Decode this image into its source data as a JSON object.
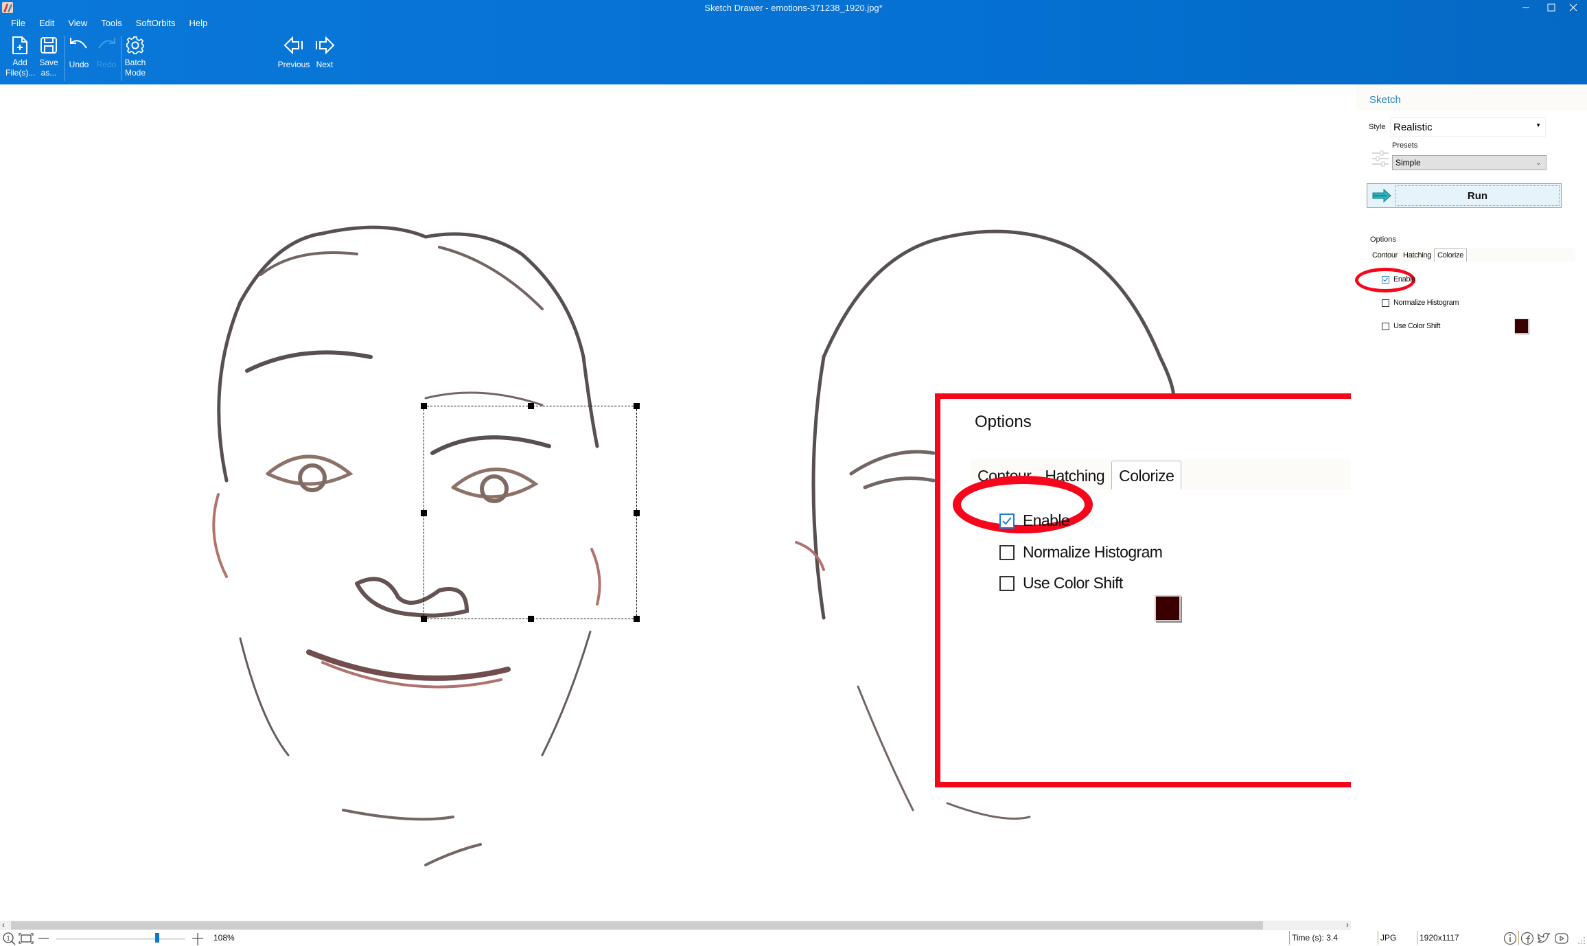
{
  "window": {
    "title": "Sketch Drawer - emotions-371238_1920.jpg*",
    "controls": [
      "minimize-icon",
      "maximize-icon",
      "close-icon"
    ]
  },
  "menu": [
    {
      "label": "File",
      "accel": "F"
    },
    {
      "label": "Edit",
      "accel": "E"
    },
    {
      "label": "View",
      "accel": "V"
    },
    {
      "label": "Tools",
      "accel": "T"
    },
    {
      "label": "SoftOrbits",
      "accel": ""
    },
    {
      "label": "Help",
      "accel": "H"
    }
  ],
  "toolbar": {
    "add_files": {
      "line1": "Add",
      "line2": "File(s)...",
      "icon": "add-file-icon"
    },
    "save_as": {
      "line1": "Save",
      "line2": "as...",
      "icon": "save-icon"
    },
    "undo": {
      "label": "Undo",
      "icon": "undo-icon"
    },
    "redo": {
      "label": "Redo",
      "icon": "redo-icon",
      "disabled": true
    },
    "batch_mode": {
      "line1": "Batch",
      "line2": "Mode",
      "icon": "gear-icon"
    },
    "previous": {
      "label": "Previous",
      "icon": "previous-arrow-icon"
    },
    "next": {
      "label": "Next",
      "icon": "next-arrow-icon"
    }
  },
  "panel": {
    "title": "Sketch",
    "style_label": "Style",
    "style_value": "Realistic",
    "presets_label": "Presets",
    "presets_value": "Simple",
    "run_label": "Run",
    "options_label": "Options",
    "tabs": [
      "Contour",
      "Hatching",
      "Colorize"
    ],
    "active_tab": "Colorize",
    "checkboxes": [
      {
        "label": "Enable",
        "checked": true
      },
      {
        "label": "Normalize Histogram",
        "checked": false
      },
      {
        "label": "Use Color Shift",
        "checked": false
      }
    ],
    "color_shift_swatch": "#3a0000"
  },
  "callout": {
    "title": "Options",
    "tabs": [
      "Contour",
      "Hatching",
      "Colorize"
    ],
    "active_tab": "Colorize",
    "checkboxes": [
      {
        "label": "Enable",
        "checked": true
      },
      {
        "label": "Normalize Histogram",
        "checked": false
      },
      {
        "label": "Use Color Shift",
        "checked": false
      }
    ],
    "swatch": "#3a0000",
    "highlight_color": "#f6061b"
  },
  "status": {
    "zoom": "108%",
    "zoom_fraction": 0.78,
    "time": "Time (s): 3.4",
    "format": "JPG",
    "dimensions": "1920x1117",
    "social_icons": [
      "info-icon",
      "facebook-icon",
      "twitter-icon",
      "youtube-icon"
    ]
  },
  "colors": {
    "header": "#0a78d8",
    "accent": "#1f86c8",
    "sketch_dark": "#3b3232",
    "sketch_red": "#a35a55"
  }
}
